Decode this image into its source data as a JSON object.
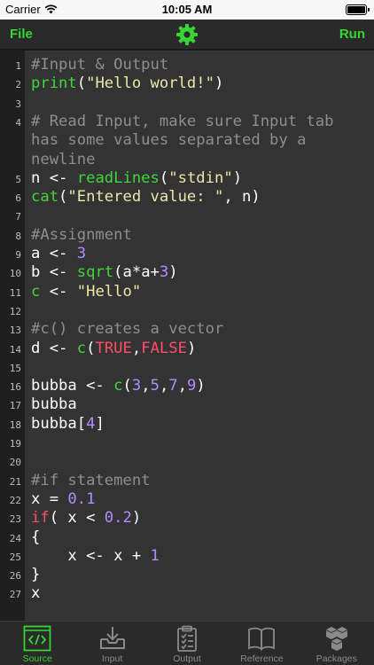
{
  "status_bar": {
    "carrier": "Carrier",
    "time": "10:05 AM",
    "battery_level": 1.0
  },
  "toolbar": {
    "file_label": "File",
    "run_label": "Run",
    "settings_icon": "gear-icon"
  },
  "editor": {
    "lines": [
      {
        "n": "1",
        "row": 0,
        "parts": [
          {
            "t": "#Input & Output",
            "c": "comment"
          }
        ]
      },
      {
        "n": "2",
        "row": 1,
        "parts": [
          {
            "t": "print",
            "c": "func"
          },
          {
            "t": "("
          },
          {
            "t": "\"Hello world!\"",
            "c": "string"
          },
          {
            "t": ")"
          }
        ]
      },
      {
        "n": "3",
        "row": 2,
        "parts": []
      },
      {
        "n": "4",
        "row": 3,
        "parts": [
          {
            "t": "# Read Input, make sure Input tab",
            "c": "comment"
          }
        ]
      },
      {
        "n": "",
        "row": 4,
        "parts": [
          {
            "t": "has some values separated by a",
            "c": "comment"
          }
        ]
      },
      {
        "n": "",
        "row": 5,
        "parts": [
          {
            "t": "newline",
            "c": "comment"
          }
        ]
      },
      {
        "n": "5",
        "row": 6,
        "parts": [
          {
            "t": "n <- "
          },
          {
            "t": "readLines",
            "c": "func"
          },
          {
            "t": "("
          },
          {
            "t": "\"stdin\"",
            "c": "string"
          },
          {
            "t": ")"
          }
        ]
      },
      {
        "n": "6",
        "row": 7,
        "parts": [
          {
            "t": "cat",
            "c": "func"
          },
          {
            "t": "("
          },
          {
            "t": "\"Entered value: \"",
            "c": "string"
          },
          {
            "t": ", n)"
          }
        ]
      },
      {
        "n": "7",
        "row": 8,
        "parts": []
      },
      {
        "n": "8",
        "row": 9,
        "parts": [
          {
            "t": "#Assignment",
            "c": "comment"
          }
        ]
      },
      {
        "n": "9",
        "row": 10,
        "parts": [
          {
            "t": "a <- "
          },
          {
            "t": "3",
            "c": "num"
          }
        ]
      },
      {
        "n": "10",
        "row": 11,
        "parts": [
          {
            "t": "b <- "
          },
          {
            "t": "sqrt",
            "c": "func"
          },
          {
            "t": "(a*a+"
          },
          {
            "t": "3",
            "c": "num"
          },
          {
            "t": ")"
          }
        ]
      },
      {
        "n": "11",
        "row": 12,
        "parts": [
          {
            "t": "c",
            "c": "func"
          },
          {
            "t": " <- "
          },
          {
            "t": "\"Hello\"",
            "c": "string"
          }
        ]
      },
      {
        "n": "12",
        "row": 13,
        "parts": []
      },
      {
        "n": "13",
        "row": 14,
        "parts": [
          {
            "t": "#c() creates a vector",
            "c": "comment"
          }
        ]
      },
      {
        "n": "14",
        "row": 15,
        "parts": [
          {
            "t": "d <- "
          },
          {
            "t": "c",
            "c": "func"
          },
          {
            "t": "("
          },
          {
            "t": "TRUE",
            "c": "kw"
          },
          {
            "t": ","
          },
          {
            "t": "FALSE",
            "c": "kw"
          },
          {
            "t": ")"
          }
        ]
      },
      {
        "n": "15",
        "row": 16,
        "parts": []
      },
      {
        "n": "16",
        "row": 17,
        "parts": [
          {
            "t": "bubba <- "
          },
          {
            "t": "c",
            "c": "func"
          },
          {
            "t": "("
          },
          {
            "t": "3",
            "c": "num"
          },
          {
            "t": ","
          },
          {
            "t": "5",
            "c": "num"
          },
          {
            "t": ","
          },
          {
            "t": "7",
            "c": "num"
          },
          {
            "t": ","
          },
          {
            "t": "9",
            "c": "num"
          },
          {
            "t": ")"
          }
        ]
      },
      {
        "n": "17",
        "row": 18,
        "parts": [
          {
            "t": "bubba"
          }
        ]
      },
      {
        "n": "18",
        "row": 19,
        "parts": [
          {
            "t": "bubba["
          },
          {
            "t": "4",
            "c": "num"
          },
          {
            "t": "]"
          }
        ]
      },
      {
        "n": "19",
        "row": 20,
        "parts": []
      },
      {
        "n": "20",
        "row": 21,
        "parts": []
      },
      {
        "n": "21",
        "row": 22,
        "parts": [
          {
            "t": "#if statement",
            "c": "comment"
          }
        ]
      },
      {
        "n": "22",
        "row": 23,
        "parts": [
          {
            "t": "x = "
          },
          {
            "t": "0.1",
            "c": "num"
          }
        ]
      },
      {
        "n": "23",
        "row": 24,
        "parts": [
          {
            "t": "if",
            "c": "kw"
          },
          {
            "t": "( x < "
          },
          {
            "t": "0.2",
            "c": "num"
          },
          {
            "t": ")"
          }
        ]
      },
      {
        "n": "24",
        "row": 25,
        "parts": [
          {
            "t": "{"
          }
        ]
      },
      {
        "n": "25",
        "row": 26,
        "parts": [
          {
            "t": "    x <- x + "
          },
          {
            "t": "1",
            "c": "num"
          }
        ]
      },
      {
        "n": "26",
        "row": 27,
        "parts": [
          {
            "t": "}"
          }
        ]
      },
      {
        "n": "27",
        "row": 28,
        "parts": [
          {
            "t": "x"
          }
        ]
      }
    ]
  },
  "tabs": [
    {
      "label": "Source",
      "icon": "code-icon",
      "active": true
    },
    {
      "label": "Input",
      "icon": "download-tray-icon",
      "active": false
    },
    {
      "label": "Output",
      "icon": "clipboard-icon",
      "active": false
    },
    {
      "label": "Reference",
      "icon": "book-icon",
      "active": false
    },
    {
      "label": "Packages",
      "icon": "boxes-icon",
      "active": false
    }
  ],
  "colors": {
    "accent": "#35d631",
    "comment": "#8e8e8e",
    "function": "#3fd63c",
    "string": "#e9e9a8",
    "number": "#b48cff",
    "keyword": "#ff4f6a",
    "editor_bg": "#333333",
    "gutter_bg": "#1f1f1f"
  }
}
